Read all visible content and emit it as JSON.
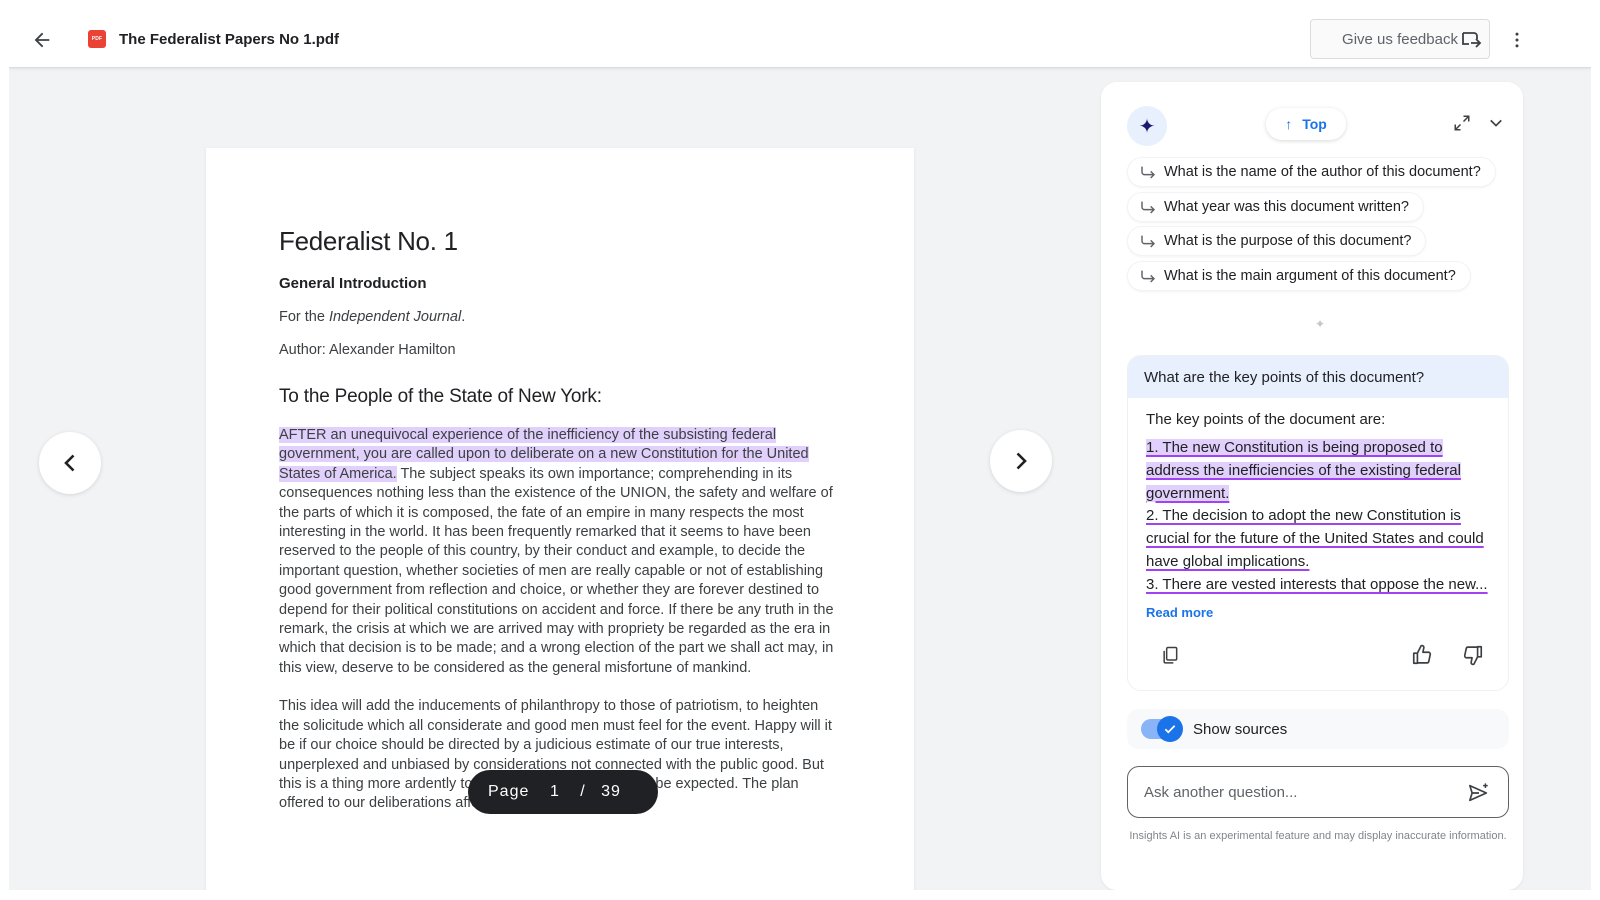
{
  "header": {
    "title": "The Federalist Papers No 1.pdf",
    "pdf_badge": "PDF",
    "feedback_label": "Give us feedback",
    "icons": [
      "back-arrow-icon",
      "pdf-file-icon",
      "open-in-new-icon",
      "more-vert-icon"
    ]
  },
  "document": {
    "title": "Federalist No. 1",
    "subtitle": "General Introduction",
    "journal_prefix": "For the ",
    "journal_name": "Independent Journal",
    "journal_suffix": ".",
    "author": "Author: Alexander Hamilton",
    "salutation": "To the People of the State of New York:",
    "para1_highlighted": "AFTER an unequivocal experience of the inefficiency of the subsisting federal government, you are called upon to deliberate on a new Constitution for the United States of America.",
    "para1_rest": " The subject speaks its own importance; comprehending in its consequences nothing less than the existence of the UNION, the safety and welfare of the parts of which it is composed, the fate of an empire in many respects the most interesting in the world. It has been frequently remarked that it seems to have been reserved to the people of this country, by their conduct and example, to decide the important question, whether societies of men are really capable or not of establishing good government from reflection and choice, or whether they are forever destined to depend for their political constitutions on accident and force. If there be any truth in the remark, the crisis at which we are arrived may with propriety be regarded as the era in which that decision is to be made; and a wrong election of the part we shall act may, in this view, deserve to be considered as the general misfortune of mankind.",
    "para2": "This idea will add the inducements of philanthropy to those of patriotism, to heighten the solicitude which all considerate and good men must feel for the event. Happy will it be if our choice should be directed by a judicious estimate of our true interests, unperplexed and unbiased by considerations not connected with the public good. But this is a thing more ardently to be wished than seriously to be expected. The plan offered to our deliberations affects"
  },
  "pager": {
    "label": "Page",
    "current": "1",
    "separator": "/",
    "total": "39"
  },
  "assistant": {
    "top_label": "Top",
    "suggestions": [
      "What is the name of the author of this document?",
      "What year was this document written?",
      "What is the purpose of this document?",
      "What is the main argument of this document?"
    ],
    "question": "What are the key points of this document?",
    "answer_lead": "The key points of the document are:",
    "answer_points": [
      "1. The new Constitution is being proposed to address the inefficiencies of the existing federal government.",
      "2. The decision to adopt the new Constitution is crucial for the future of the United States and could have global implications.",
      "3. There are vested interests that oppose the new..."
    ],
    "read_more": "Read more",
    "show_sources_label": "Show sources",
    "show_sources_on": true,
    "ask_placeholder": "Ask another question...",
    "disclaimer": "Insights AI is an experimental feature and may display inaccurate information.",
    "accent": "#1a73e8",
    "highlight": "#e1d0fb"
  }
}
